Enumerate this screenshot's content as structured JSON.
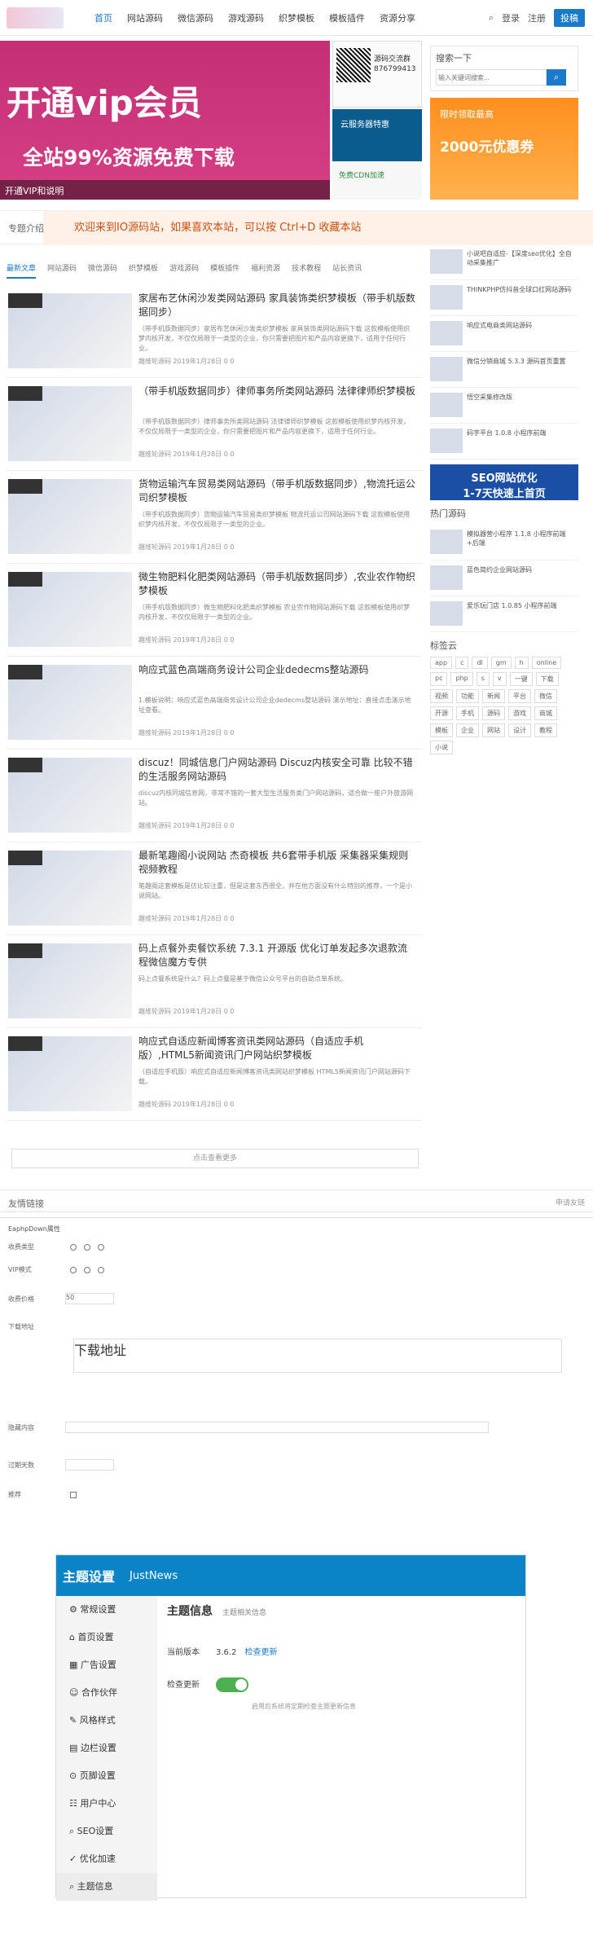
{
  "header": {
    "nav": [
      "首页",
      "网站源码",
      "微信源码",
      "游戏源码",
      "织梦模板",
      "模板插件",
      "资源分享"
    ],
    "login": "登录",
    "register": "注册",
    "contribute": "投稿"
  },
  "banner": {
    "title": "开通vip会员",
    "subtitle": "全站99%资源免费下载",
    "caption": "开通VIP和说明"
  },
  "promo": {
    "qr_text": "源码交流群 876799413",
    "ad2": "云服务器特惠",
    "ad3": "免费CDN加速",
    "side_ad": "限时领取最高",
    "side_ad_big": "2000元优惠券"
  },
  "search": {
    "title": "搜索一下",
    "placeholder": "输入关键词搜索..."
  },
  "notice": {
    "left": "专题介绍",
    "msg": "欢迎来到IO源码站，如果喜欢本站，可以按 Ctrl+D 收藏本站"
  },
  "tabs": [
    "最新文章",
    "网站源码",
    "微信源码",
    "织梦模板",
    "游戏源码",
    "模板插件",
    "福利资源",
    "技术教程",
    "站长资讯"
  ],
  "articles": [
    {
      "title": "家居布艺休闲沙发类网站源码 家具装饰类织梦模板（带手机版数据同步）",
      "desc": "（带手机版数据同步）家居布艺休闲沙发类织梦模板 家具装饰类网站源码下载 这款模板使用织梦内核开发，不仅仅局限于一类型的企业，你只需要把图片和产品内容更换下，适用于任何行业。",
      "meta": "趣维轮源码 2019年1月28日 0 0"
    },
    {
      "title": "（带手机版数据同步）律师事务所类网站源码 法律律师织梦模板",
      "desc": "（带手机版数据同步）律师事务所类网站源码 法律律师织梦模板 这款模板使用织梦内核开发，不仅仅局限于一类型的企业，你只需要把图片和产品内容更换下，适用于任何行业。",
      "meta": "趣维轮源码 2019年1月28日 0 0"
    },
    {
      "title": "货物运输汽车贸易类网站源码（带手机版数据同步）,物流托运公司织梦模板",
      "desc": "（带手机版数据同步）货物运输汽车贸易类织梦模板 物流托运公司网站源码下载 这款模板使用织梦内核开发，不仅仅局限于一类型的企业。",
      "meta": "趣维轮源码 2019年1月28日 0 0"
    },
    {
      "title": "微生物肥料化肥类网站源码（带手机版数据同步）,农业农作物织梦模板",
      "desc": "（带手机版数据同步）微生物肥料化肥类织梦模板 农业农作物网站源码下载 这款模板使用织梦内核开发，不仅仅局限于一类型的企业。",
      "meta": "趣维轮源码 2019年1月28日 0 0"
    },
    {
      "title": "响应式蓝色高端商务设计公司企业dedecms整站源码",
      "desc": "1.模板说明：响应式蓝色高端商务设计公司企业dedecms整站源码 演示地址：直接点击演示地址查看。",
      "meta": "趣维轮源码 2019年1月28日 0 0"
    },
    {
      "title": "discuz！同城信息门户网站源码 Discuz内核安全可靠 比较不错的生活服务网站源码",
      "desc": "discuz内核同城信息网，非常不错的一套大型生活服务类门户网站源码，适合做一座户外旅游网站。",
      "meta": "趣维轮源码 2019年1月28日 0 0"
    },
    {
      "title": "最新笔趣阁小说网站 杰奇模板 共6套带手机版 采集器采集规则视频教程",
      "desc": "笔趣阁这套模板是仿比较注重，但是这套东西很全，并在他方面没有什么特别的推荐，一个是小说网站。",
      "meta": "趣维轮源码 2019年1月28日 0 0"
    },
    {
      "title": "码上点餐外卖餐饮系统 7.3.1 开源版 优化订单发起多次退款流程微信魔方专供",
      "desc": "码上点餐系统是什么？码上点餐是基于微信公众号平台的自助点单系统。",
      "meta": "趣维轮源码 2019年1月28日 0 0"
    },
    {
      "title": "响应式自适应新闻博客资讯类网站源码（自适应手机版）,HTML5新闻资讯门户网站织梦模板",
      "desc": "（自适应手机版）响应式自适应新闻博客资讯类网站织梦模板 HTML5新闻资讯门户网站源码下载。",
      "meta": "趣维轮源码 2019年1月28日 0 0"
    }
  ],
  "more": "点击查看更多",
  "sidebar": {
    "items": [
      "小说吧自适应-【深度seo优化】全自动采集推广",
      "THINKPHP仿抖音全球口红网站源码",
      "响应式电商类网站源码",
      "微信分销商城 5.3.3 源码首页重置",
      "悟空采集修改版",
      "码字平台 1.0.8 小程序前端"
    ],
    "seo": "SEO网站优化",
    "seo_sub": "1-7天快速上首页",
    "hot_title": "热门源码",
    "hot_items": [
      "模拟器营小程序 1.1.8 小程序前端+后端",
      "蓝色简约企业网站源码",
      "爱乐玩门店 1.0.85 小程序前端"
    ],
    "tag_title": "标签云",
    "tags": [
      "app",
      "c",
      "dl",
      "gm",
      "h",
      "online",
      "pc",
      "php",
      "s",
      "v",
      "一键",
      "下载",
      "视频",
      "功能",
      "新闻",
      "平台",
      "微信",
      "开源",
      "手机",
      "源码",
      "游戏",
      "商城",
      "模板",
      "企业",
      "网站",
      "设计",
      "教程",
      "小说"
    ]
  },
  "friend": {
    "left": "友情链接",
    "right": "申请友链"
  },
  "settings": {
    "title": "EaphpDown属性",
    "rows": [
      "收费类型",
      "VIP模式",
      "收费价格",
      "下载地址",
      "隐藏内容",
      "过期天数",
      "推荐"
    ],
    "price": "50",
    "desc": "下载地址"
  },
  "theme": {
    "top": "主题设置",
    "brand": "JustNews",
    "menu": [
      "常规设置",
      "首页设置",
      "广告设置",
      "合作伙伴",
      "风格样式",
      "边栏设置",
      "页脚设置",
      "用户中心",
      "SEO设置",
      "优化加速",
      "主题信息"
    ],
    "title": "主题信息",
    "subtitle": "主题相关信息",
    "current_version_label": "当前版本",
    "current_version": "3.6.2",
    "check_update": "检查更新",
    "update_label": "检查更新",
    "update_note": "启用后系统将定期检查主题更新信息"
  }
}
